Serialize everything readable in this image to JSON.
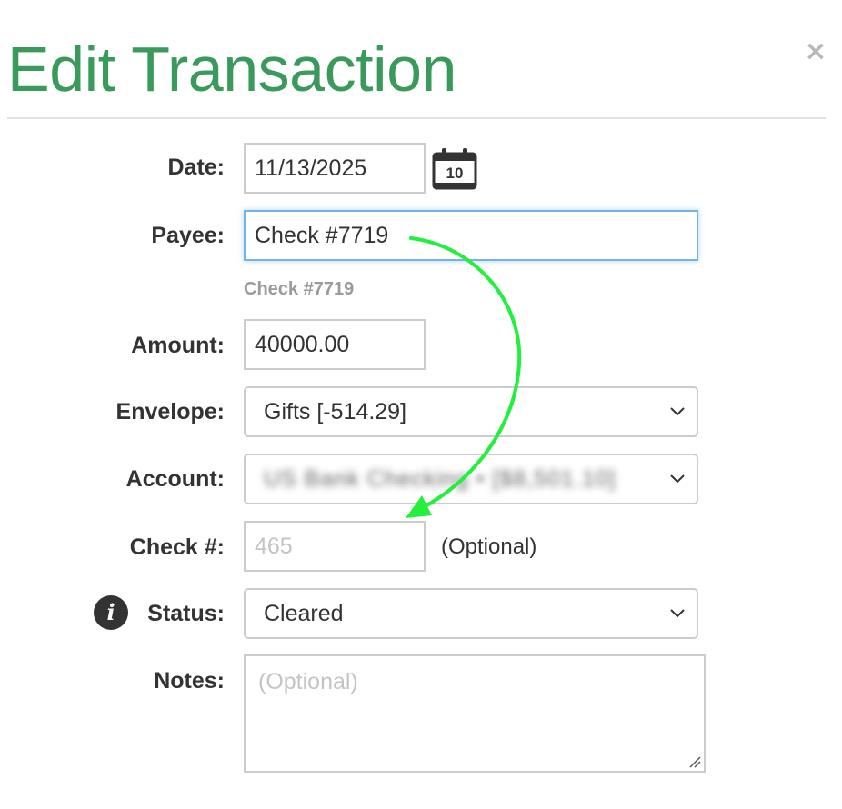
{
  "dialog": {
    "title": "Edit Transaction",
    "close_glyph": "×"
  },
  "fields": {
    "date": {
      "label": "Date:",
      "value": "11/13/2025",
      "calendar_day": "10"
    },
    "payee": {
      "label": "Payee:",
      "value": "Check #7719",
      "suggestion": "Check #7719"
    },
    "amount": {
      "label": "Amount:",
      "value": "40000.00"
    },
    "envelope": {
      "label": "Envelope:",
      "selected": "Gifts [-514.29]"
    },
    "account": {
      "label": "Account:",
      "selected": "US Bank Checking • [$8,501.10]"
    },
    "check_number": {
      "label": "Check #:",
      "placeholder": "465",
      "optional_note": "(Optional)"
    },
    "status": {
      "label": "Status:",
      "selected": "Cleared",
      "info_glyph": "i"
    },
    "notes": {
      "label": "Notes:",
      "placeholder": "(Optional)"
    }
  },
  "colors": {
    "title": "#3a9a5c",
    "annotation_arrow": "#22f03c",
    "focus_border": "#76b3e4"
  },
  "icons": [
    "close-icon",
    "calendar-icon",
    "chevron-down-icon",
    "info-icon",
    "resize-handle-icon"
  ]
}
